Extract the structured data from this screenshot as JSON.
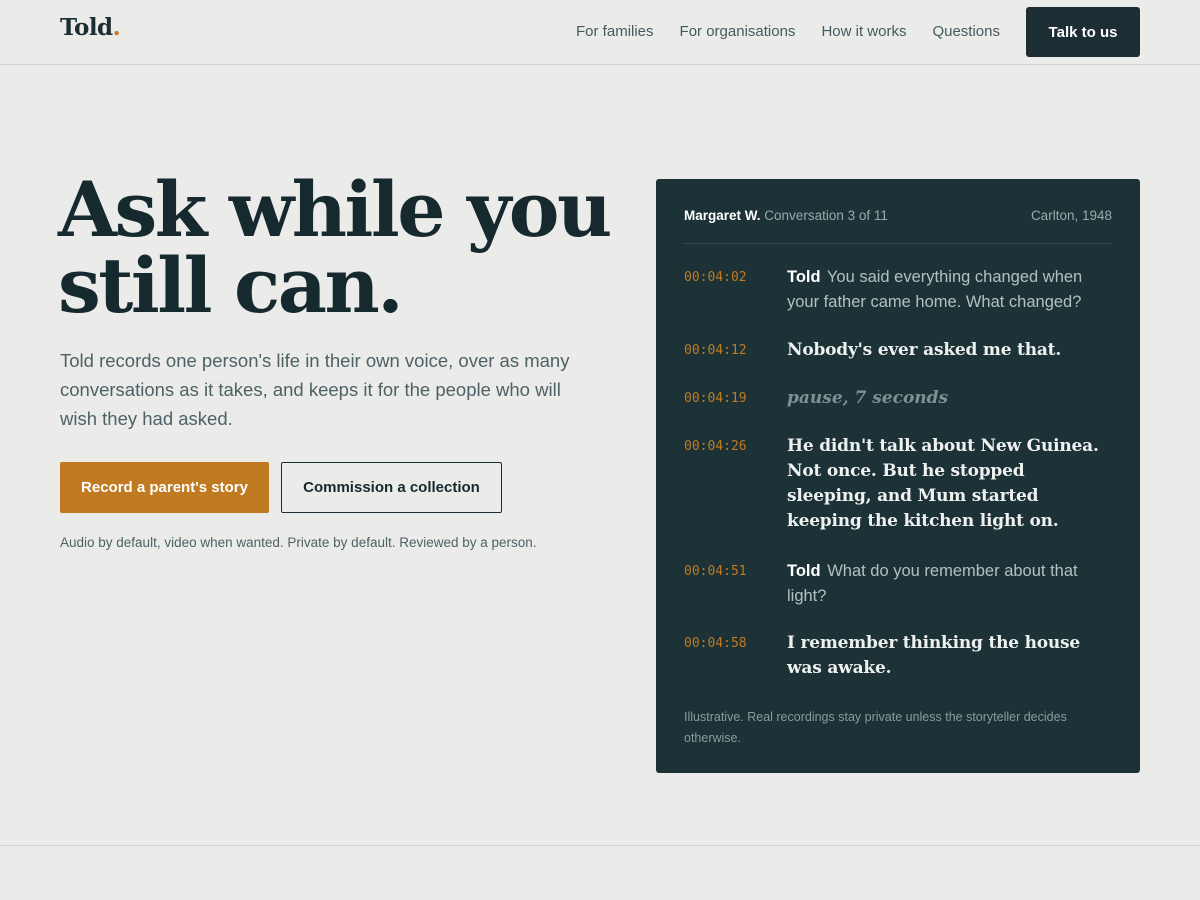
{
  "brand": {
    "name": "Told",
    "dot": "."
  },
  "nav": {
    "items": [
      "For families",
      "For organisations",
      "How it works",
      "Questions"
    ],
    "cta": "Talk to us"
  },
  "hero": {
    "headline_line1": "Ask while you",
    "headline_line2": "still can.",
    "lede": "Told records one person's life in their own voice, over as many conversations as it takes, and keeps it for the people who will wish they had asked.",
    "primary_button": "Record a parent's story",
    "secondary_button": "Commission a collection",
    "footnote": "Audio by default, video when wanted. Private by default. Reviewed by a person."
  },
  "transcript": {
    "storyteller": "Margaret W.",
    "conversation": "Conversation 3 of 11",
    "place_year": "Carlton, 1948",
    "lines": [
      {
        "time": "00:04:02",
        "speaker": "Told",
        "text": "You said everything changed when your father came home. What changed?"
      },
      {
        "time": "00:04:12",
        "speaker": "",
        "text": "Nobody's ever asked me that."
      },
      {
        "time": "00:04:19",
        "speaker": "",
        "text": "pause, 7 seconds"
      },
      {
        "time": "00:04:26",
        "speaker": "",
        "text": "He didn't talk about New Guinea. Not once. But he stopped sleeping, and Mum started keeping the kitchen light on."
      },
      {
        "time": "00:04:51",
        "speaker": "Told",
        "text": "What do you remember about that light?"
      },
      {
        "time": "00:04:58",
        "speaker": "",
        "text": "I remember thinking the house was awake."
      }
    ],
    "note": "Illustrative. Real recordings stay private unless the storyteller decides otherwise."
  },
  "colors": {
    "background": "#ebece9",
    "ink": "#1c2e33",
    "accent": "#c07a22",
    "card": "#1c3236"
  }
}
